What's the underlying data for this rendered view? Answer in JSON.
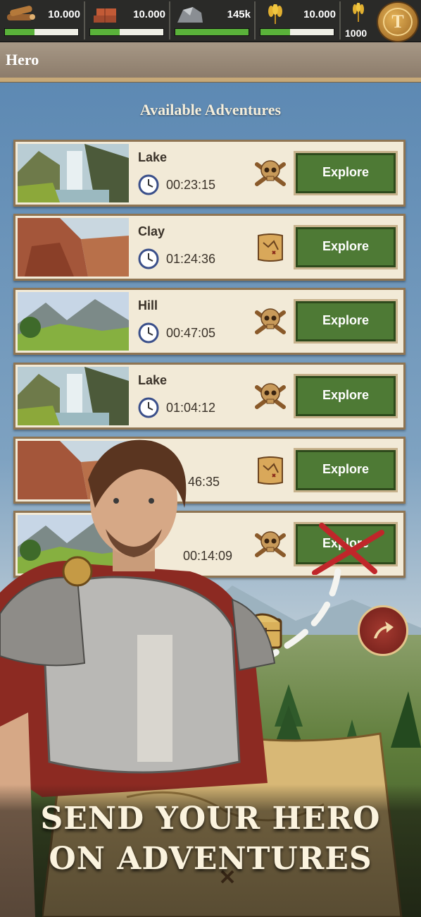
{
  "resources": [
    {
      "name": "wood",
      "value": "10.000",
      "fill": 0.4
    },
    {
      "name": "clay",
      "value": "10.000",
      "fill": 0.4
    },
    {
      "name": "iron",
      "value": "145k",
      "fill": 1.0
    },
    {
      "name": "crop",
      "value": "10.000",
      "fill": 0.4
    }
  ],
  "crop_production": "1000",
  "gold_coin_letter": "T",
  "header": {
    "title": "Hero"
  },
  "section_title": "Available Adventures",
  "adventures": [
    {
      "name": "Lake",
      "time": "00:23:15",
      "difficulty": "skull-icon",
      "button": "Explore"
    },
    {
      "name": "Clay",
      "time": "01:24:36",
      "difficulty": "map-scroll-icon",
      "button": "Explore"
    },
    {
      "name": "Hill",
      "time": "00:47:05",
      "difficulty": "skull-icon",
      "button": "Explore"
    },
    {
      "name": "Lake",
      "time": "01:04:12",
      "difficulty": "skull-icon",
      "button": "Explore"
    },
    {
      "name": "",
      "time": "46:35",
      "difficulty": "map-scroll-icon",
      "button": "Explore"
    },
    {
      "name": "",
      "time": "00:14:09",
      "difficulty": "skull-icon",
      "button": "Explore"
    }
  ],
  "banner": {
    "line1": "SEND YOUR HERO",
    "line2": "ON ADVENTURES"
  },
  "colors": {
    "explore_green": "#4e7a35",
    "row_bg": "#f2ead7",
    "row_border": "#8f7553",
    "x_mark": "#c0262a"
  }
}
